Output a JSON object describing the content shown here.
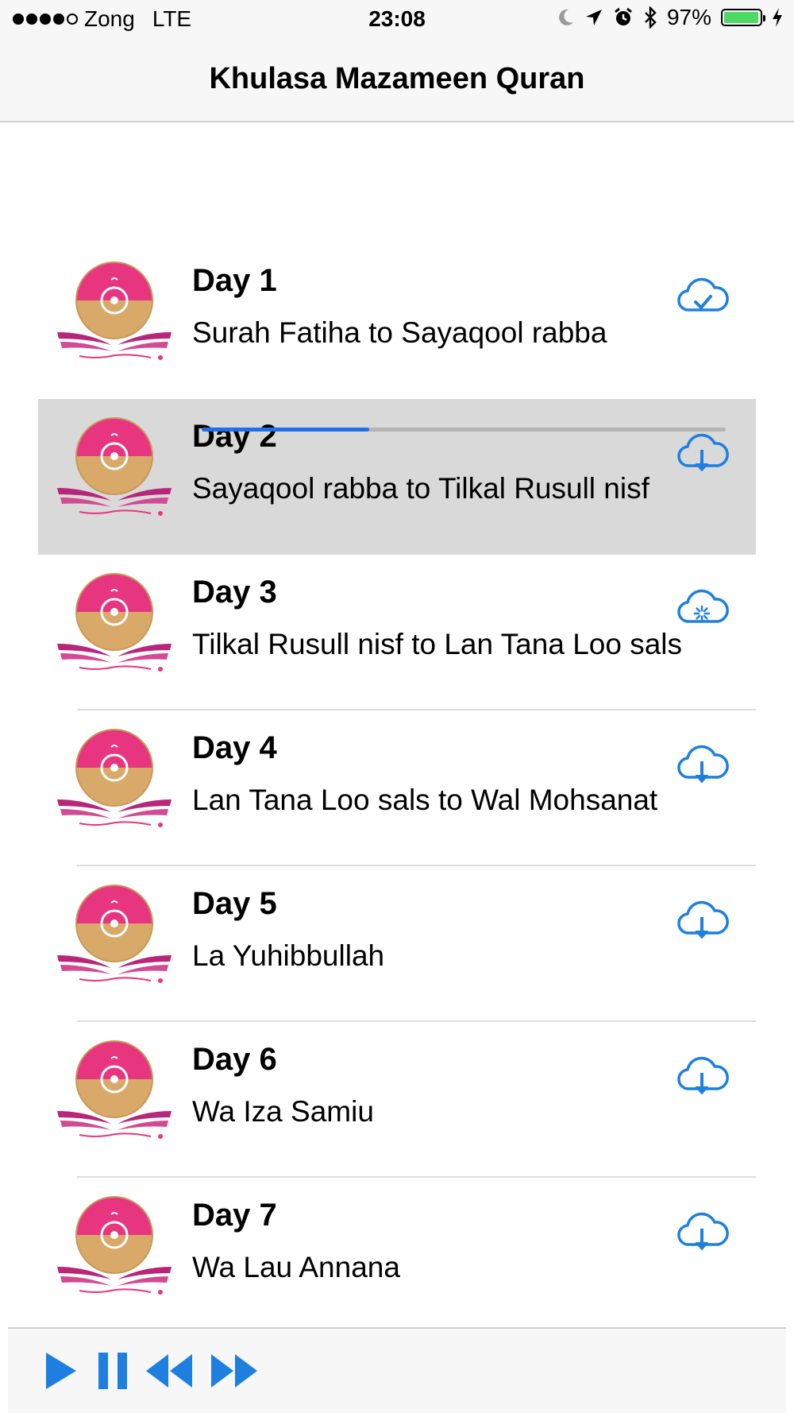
{
  "status_bar": {
    "carrier": "Zong",
    "network": "LTE",
    "time": "23:08",
    "battery_percent": "97%",
    "battery_level": 0.97,
    "icons": [
      "moon-icon",
      "location-arrow-icon",
      "alarm-icon",
      "bluetooth-icon",
      "battery-icon",
      "charging-bolt-icon"
    ]
  },
  "nav": {
    "title": "Khulasa Mazameen Quran"
  },
  "episodes": [
    {
      "title": "Day  1",
      "subtitle": "Surah Fatiha to Sayaqool rabba",
      "status": "downloaded"
    },
    {
      "title": "Day  2",
      "subtitle": "Sayaqool rabba to Tilkal Rusull nisf",
      "status": "download",
      "selected": true
    },
    {
      "title": "Day  3",
      "subtitle": "Tilkal Rusull nisf to Lan Tana Loo sals",
      "status": "downloading",
      "progress": 0.32
    },
    {
      "title": "Day  4",
      "subtitle": "Lan Tana Loo sals to Wal Mohsanat",
      "status": "download"
    },
    {
      "title": "Day  5",
      "subtitle": "La Yuhibbullah",
      "status": "download"
    },
    {
      "title": "Day  6",
      "subtitle": "Wa Iza Samiu",
      "status": "download"
    },
    {
      "title": "Day  7",
      "subtitle": "Wa Lau Annana",
      "status": "download"
    }
  ],
  "player": {
    "controls": [
      "play-icon",
      "pause-icon",
      "rewind-icon",
      "fast-forward-icon"
    ]
  },
  "colors": {
    "accent": "#1e7fe0",
    "logo_pink": "#e8357f",
    "logo_gold": "#d9a96a",
    "selected_row": "#d9d9d9",
    "battery": "#4cd964"
  }
}
